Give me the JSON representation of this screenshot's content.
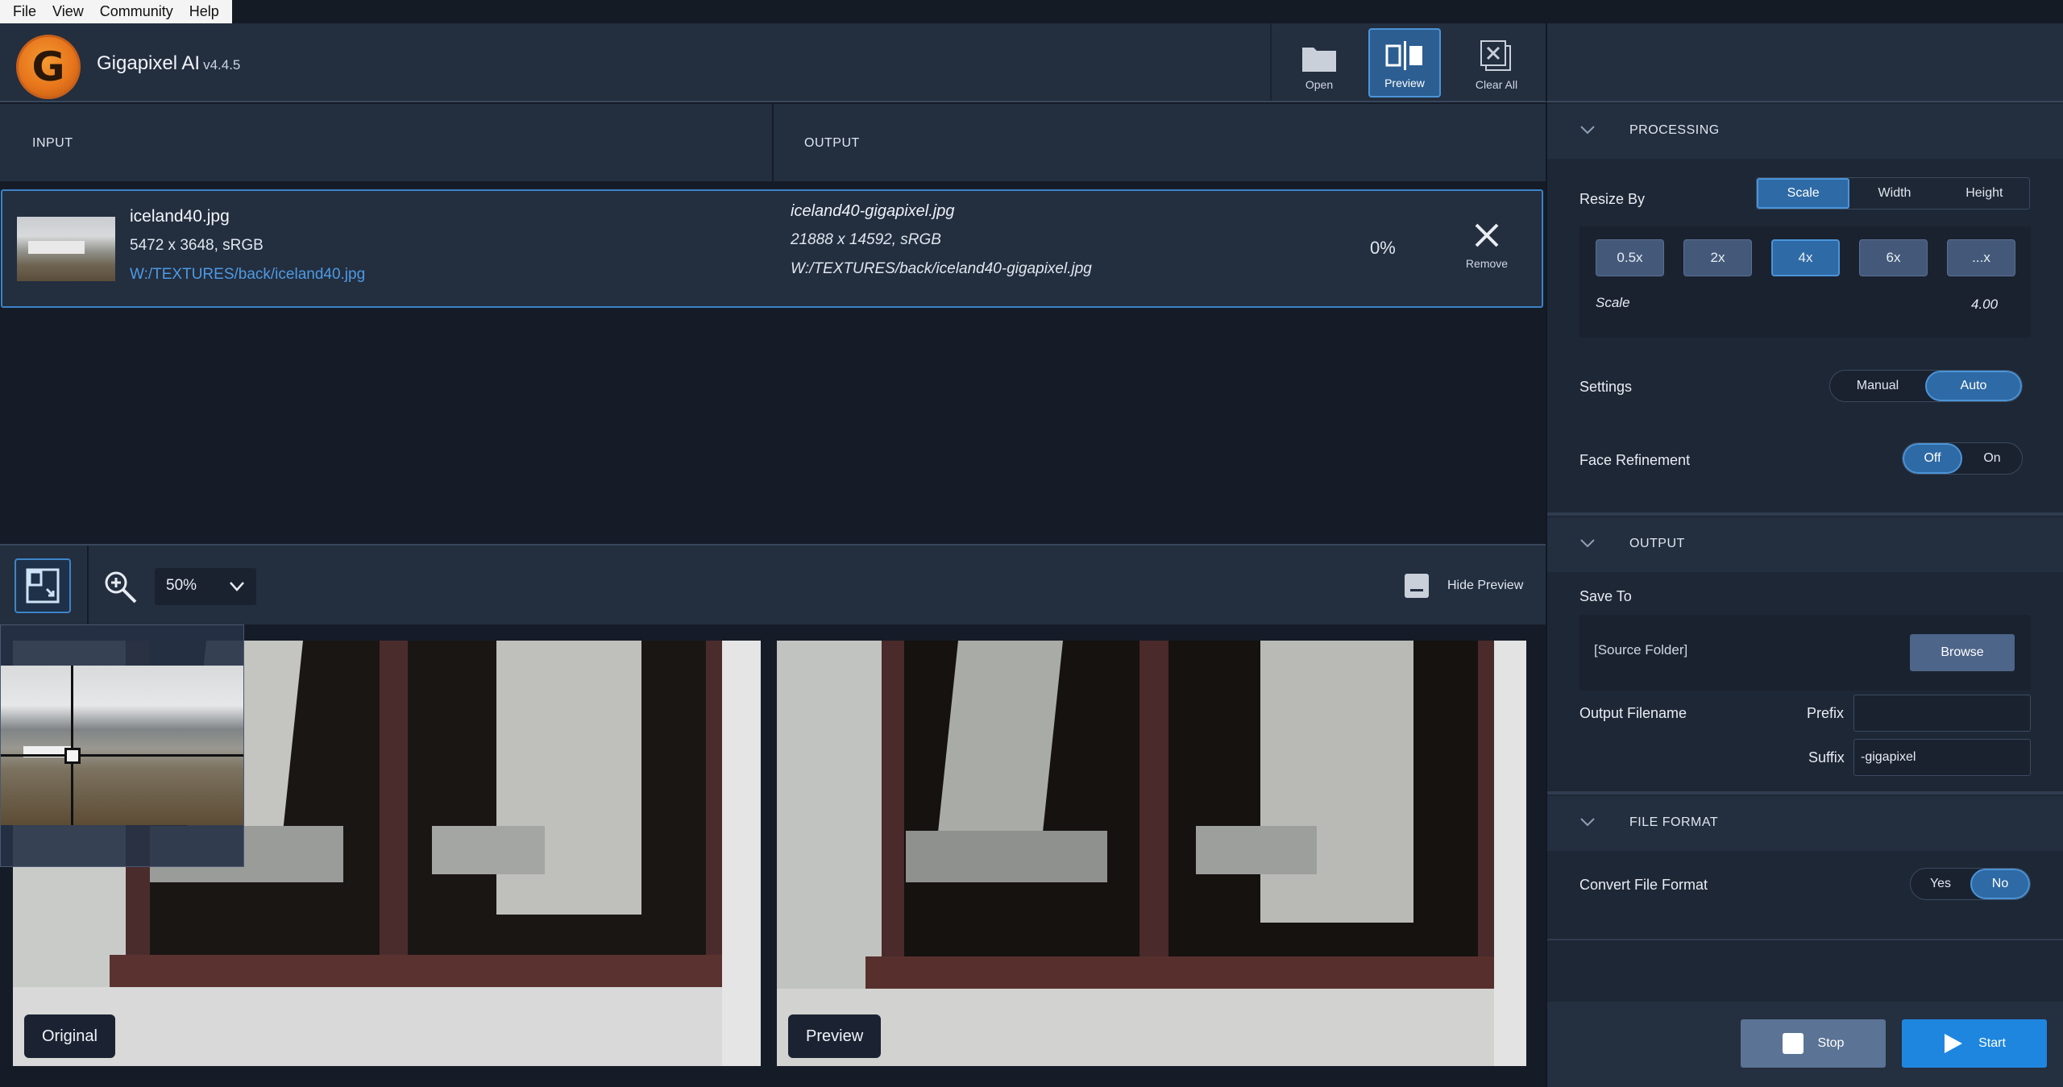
{
  "menu": [
    "File",
    "View",
    "Community",
    "Help"
  ],
  "app": {
    "name": "Gigapixel AI",
    "version": "v4.4.5",
    "logo_letter": "G"
  },
  "toolbar": {
    "open_label": "Open",
    "preview_label": "Preview",
    "clear_all_label": "Clear All"
  },
  "columns": {
    "input": "INPUT",
    "output": "OUTPUT"
  },
  "file": {
    "input_name": "iceland40.jpg",
    "input_dims": "5472 x 3648, sRGB",
    "input_path": "W:/TEXTURES/back/iceland40.jpg",
    "output_name": "iceland40-gigapixel.jpg",
    "output_dims": "21888 x 14592, sRGB",
    "output_path": "W:/TEXTURES/back/iceland40-gigapixel.jpg",
    "progress": "0%",
    "remove_label": "Remove"
  },
  "preview": {
    "zoom": "50%",
    "hide_label": "Hide Preview",
    "original_label": "Original",
    "preview_label": "Preview"
  },
  "processing": {
    "header": "PROCESSING",
    "resize_by_label": "Resize By",
    "resize_tabs": [
      "Scale",
      "Width",
      "Height"
    ],
    "scale_buttons": [
      "0.5x",
      "2x",
      "4x",
      "6x",
      "...x"
    ],
    "scale_label": "Scale",
    "scale_value": "4.00",
    "settings_label": "Settings",
    "settings_options": [
      "Manual",
      "Auto"
    ],
    "face_label": "Face Refinement",
    "face_options": [
      "Off",
      "On"
    ]
  },
  "output": {
    "header": "OUTPUT",
    "save_to_label": "Save To",
    "folder": "[Source Folder]",
    "browse_label": "Browse",
    "filename_label": "Output Filename",
    "prefix_label": "Prefix",
    "prefix_value": "",
    "suffix_label": "Suffix",
    "suffix_value": "-gigapixel"
  },
  "file_format": {
    "header": "FILE FORMAT",
    "convert_label": "Convert File Format",
    "options": [
      "Yes",
      "No"
    ]
  },
  "actions": {
    "stop_label": "Stop",
    "start_label": "Start"
  }
}
